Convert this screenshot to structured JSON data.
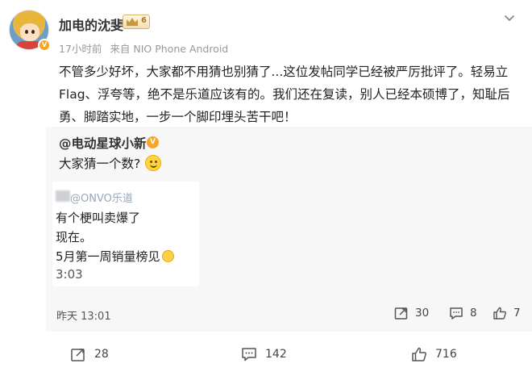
{
  "post": {
    "user_name": "加电的沈斐",
    "vip_level": "6",
    "time": "17小时前",
    "source": "来自 NIO Phone Android",
    "body": "不管多少好坏，大家都不用猜也别猜了...这位发帖同学已经被严厉批评了。轻易立Flag、浮夸等，绝不是乐道应该有的。我们还在复读，别人已经本硕博了，知耻后勇、脚踏实地，一步一个脚印埋头苦干吧！"
  },
  "repost": {
    "author": "@电动星球小新",
    "text": "大家猜一个数?",
    "image": {
      "handle": "@ONVO乐道",
      "line1": "有个梗叫卖爆了",
      "line2": "现在。",
      "line3": "5月第一周销量榜见",
      "line4": "3:03"
    },
    "time": "昨天 13:01",
    "reposts": "30",
    "comments": "8",
    "likes": "7"
  },
  "actions": {
    "reposts": "28",
    "comments": "142",
    "likes": "716"
  },
  "icons": {
    "verified": "verified-badge-icon",
    "vip": "vip-crown-icon",
    "more": "chevron-down-icon",
    "repost": "repost-icon",
    "comment": "comment-icon",
    "like": "thumbs-up-icon"
  },
  "colors": {
    "badge": "#f5a623",
    "repost_bg": "#f7f7f7",
    "meta_text": "#999999"
  }
}
